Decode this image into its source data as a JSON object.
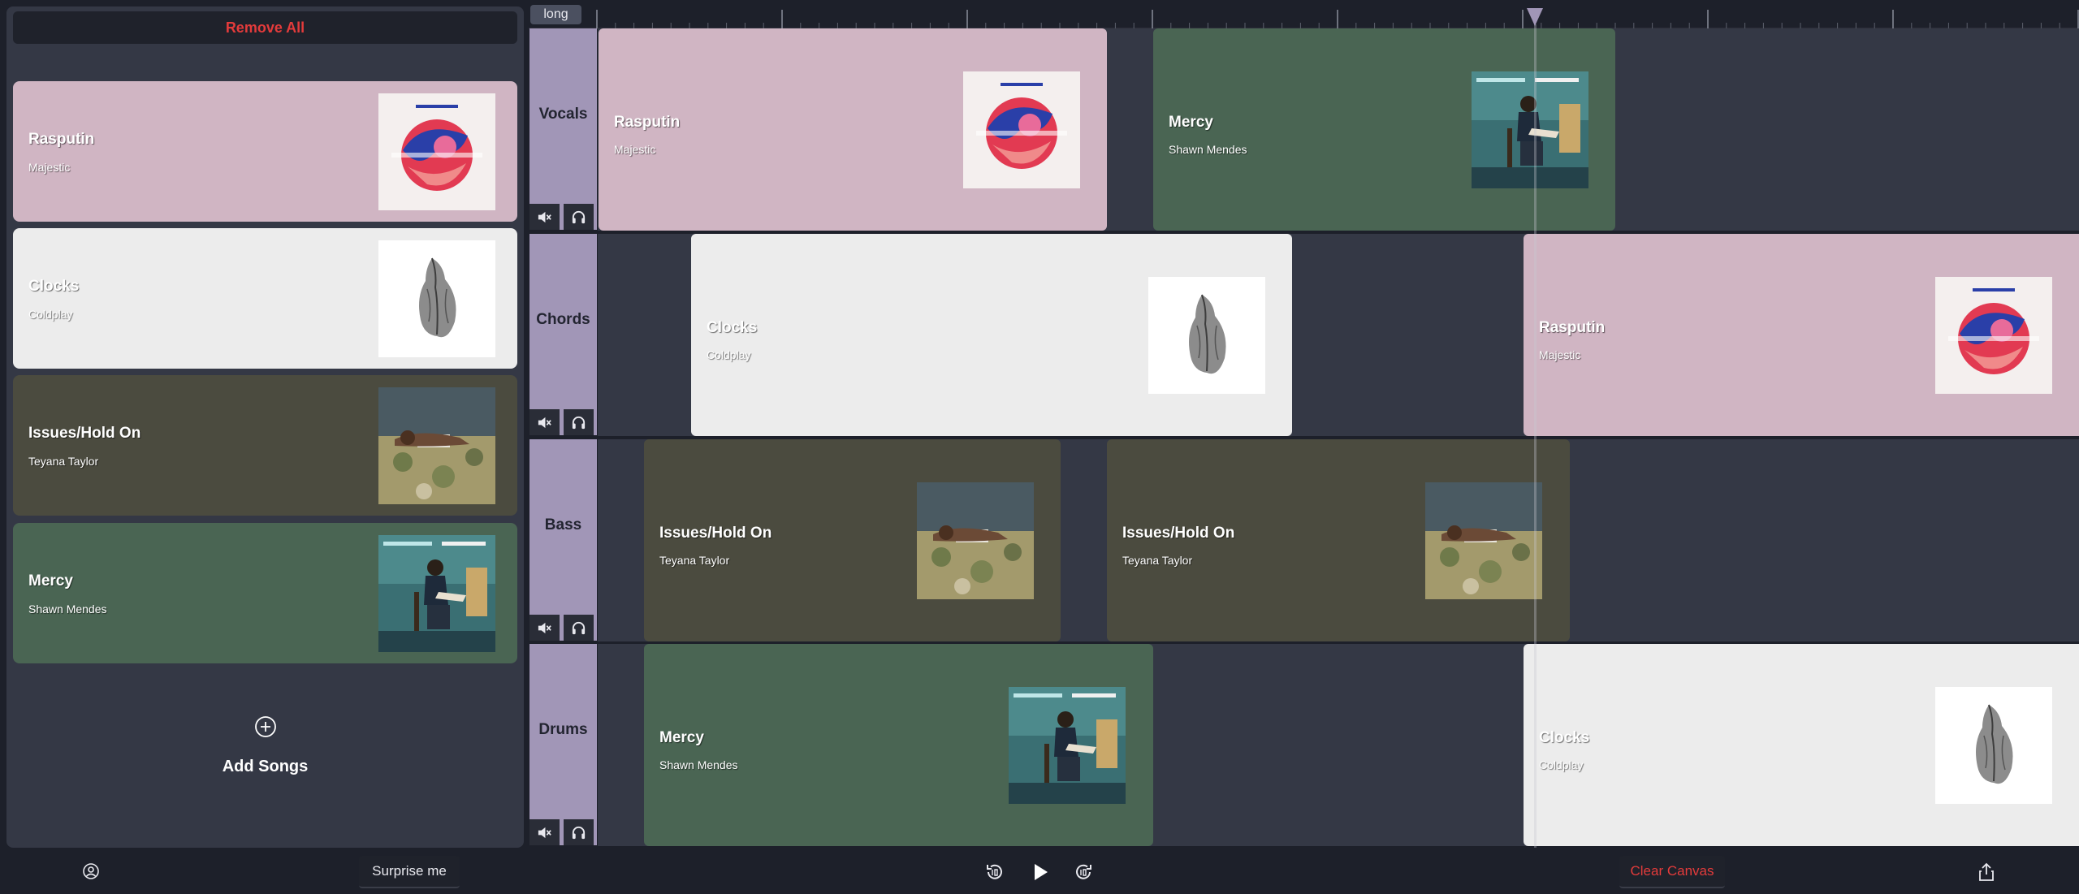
{
  "sidebar": {
    "remove_all": "Remove All",
    "songs": [
      {
        "title": "Rasputin",
        "artist": "Majestic",
        "color": "#d0b5c3"
      },
      {
        "title": "Clocks",
        "artist": "Coldplay",
        "color": "#ececec"
      },
      {
        "title": "Issues/Hold On",
        "artist": "Teyana Taylor",
        "color": "#4b4b3f"
      },
      {
        "title": "Mercy",
        "artist": "Shawn Mendes",
        "color": "#4a6553"
      }
    ],
    "add_songs": "Add Songs"
  },
  "bottom_bar": {
    "surprise": "Surprise me",
    "clear_canvas": "Clear Canvas"
  },
  "timeline": {
    "zoom": "long",
    "tracks": [
      {
        "name": "Vocals"
      },
      {
        "name": "Chords"
      },
      {
        "name": "Bass"
      },
      {
        "name": "Drums"
      }
    ],
    "clips": {
      "vocals": [
        {
          "title": "Rasputin",
          "artist": "Majestic"
        },
        {
          "title": "Mercy",
          "artist": "Shawn Mendes"
        }
      ],
      "chords": [
        {
          "title": "Clocks",
          "artist": "Coldplay"
        },
        {
          "title": "Rasputin",
          "artist": "Majestic"
        }
      ],
      "bass": [
        {
          "title": "Issues/Hold On",
          "artist": "Teyana Taylor"
        },
        {
          "title": "Issues/Hold On",
          "artist": "Teyana Taylor"
        }
      ],
      "drums": [
        {
          "title": "Mercy",
          "artist": "Shawn Mendes"
        },
        {
          "title": "Clocks",
          "artist": "Coldplay"
        }
      ]
    }
  },
  "colors": {
    "rasputin": "#d0b5c3",
    "clocks": "#ececec",
    "issues": "#4b4b3f",
    "mercy": "#4a6553",
    "track_label": "#a196b7",
    "danger": "#e33b3b",
    "playhead": "#a196b7"
  }
}
